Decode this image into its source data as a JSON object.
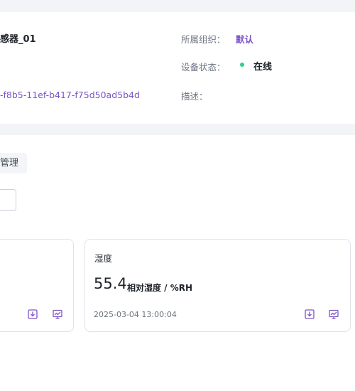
{
  "device": {
    "name_fragment": "感器_01",
    "id_fragment": "-f8b5-11ef-b417-f75d50ad5b4d",
    "org_label": "所属组织：",
    "org_value": "默认",
    "status_label": "设备状态：",
    "status_value": "在线",
    "status_color": "#2fcf8a",
    "description_label": "描述：",
    "description_value": ""
  },
  "tabs": {
    "active_fragment": "管理"
  },
  "cards": [
    {
      "title": "湿度",
      "value": "55.4",
      "unit": "相对湿度 / %RH",
      "timestamp": "2025-03-04 13:00:04",
      "icons": [
        "download-icon",
        "chart-icon"
      ]
    }
  ],
  "theme": {
    "accent": "#7b55c7",
    "page_gap": "#f3f4f8",
    "card_border": "#dfe2e8"
  }
}
